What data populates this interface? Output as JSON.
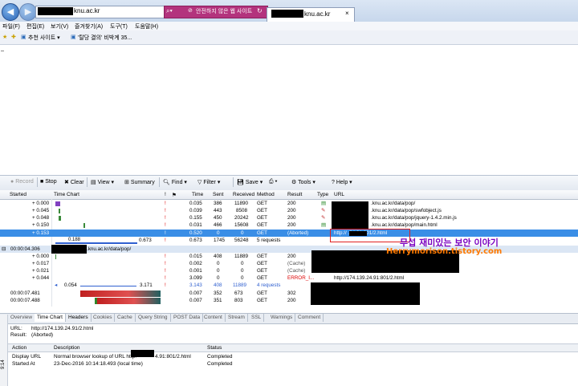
{
  "browser": {
    "address_host": "knu.ac.kr",
    "warning": "안전하지 않은 웹 사이트",
    "tab_title": "knu.ac.kr",
    "menu": [
      "파일(F)",
      "편집(E)",
      "보기(V)",
      "즐겨찾기(A)",
      "도구(T)",
      "도움말(H)"
    ],
    "favorites": [
      "추천 사이트 ▾",
      "'탈당 결의' 비박계 35..."
    ]
  },
  "fiddler": {
    "toolbar": [
      "Record",
      "Stop",
      "Clear",
      "View ▾",
      "Summary",
      "Find ▾",
      "Filter ▾",
      "Save ▾",
      "Tools ▾",
      "Help ▾"
    ],
    "columns": [
      "Started",
      "Time Chart",
      "!",
      "Time",
      "Sent",
      "Received",
      "Method",
      "Result",
      "Type",
      "URL"
    ],
    "rows": [
      {
        "started": "+ 0.000",
        "flag": "!",
        "time": "0.035",
        "sent": "386",
        "received": "11890",
        "method": "GET",
        "result": "200",
        "url": ".knu.ac.kr/data/pop/"
      },
      {
        "started": "+ 0.045",
        "flag": "!",
        "time": "0.039",
        "sent": "443",
        "received": "8508",
        "method": "GET",
        "result": "200",
        "url": ".knu.ac.kr/data/pop/swfobject.js"
      },
      {
        "started": "+ 0.048",
        "flag": "!",
        "time": "0.155",
        "sent": "450",
        "received": "20242",
        "method": "GET",
        "result": "200",
        "url": ".knu.ac.kr/data/pop/jquery-1.4.2.min.js"
      },
      {
        "started": "+ 0.150",
        "flag": "!",
        "time": "0.031",
        "sent": "466",
        "received": "15608",
        "method": "GET",
        "result": "200",
        "url": ".knu.ac.kr/data/pop/main.html"
      },
      {
        "started": "+ 0.153",
        "flag": "!",
        "time": "0.520",
        "sent": "0",
        "received": "0",
        "method": "GET",
        "result": "(Aborted)",
        "url": "http://    .24.91:801/2.html"
      }
    ],
    "summary1": {
      "start": "0.188",
      "end": "0.673",
      "flag": "!",
      "time": "0.673",
      "sent": "1745",
      "received": "56248",
      "requests": "5 requests"
    },
    "group": {
      "started": "00:00:04.306",
      "url": ".knu.ac.kr/data/pop/"
    },
    "rows2": [
      {
        "started": "+ 0.000",
        "flag": "!",
        "time": "0.015",
        "sent": "408",
        "received": "11889",
        "method": "GET",
        "result": "200"
      },
      {
        "started": "+ 0.017",
        "flag": "!",
        "time": "0.002",
        "sent": "0",
        "received": "0",
        "method": "GET",
        "result": "(Cache)"
      },
      {
        "started": "+ 0.021",
        "flag": "!",
        "time": "0.001",
        "sent": "0",
        "received": "0",
        "method": "GET",
        "result": "(Cache)"
      },
      {
        "started": "+ 0.044",
        "flag": "!",
        "time": "3.099",
        "sent": "0",
        "received": "0",
        "method": "GET",
        "result": "ERROR_I...",
        "url": "http://174.139.24.91:801/2.html"
      }
    ],
    "summary2": {
      "start": "0.054",
      "end": "3.171",
      "flag": "!",
      "time": "3.143",
      "sent": "408",
      "received": "11889",
      "requests": "4 requests"
    },
    "rows3": [
      {
        "started": "00:00:07.481",
        "time": "0.007",
        "sent": "352",
        "received": "673",
        "method": "GET",
        "result": "302"
      },
      {
        "started": "00:00:07.488",
        "time": "0.007",
        "sent": "351",
        "received": "803",
        "method": "GET",
        "result": "200"
      }
    ],
    "tabs": [
      "Overview",
      "Time Chart",
      "Headers",
      "Cookies",
      "Cache",
      "Query String",
      "POST Data",
      "Content",
      "Stream",
      "SSL",
      "Warnings",
      "Comment"
    ],
    "detail": {
      "url_label": "URL:",
      "url_value": "http://174.139.24.91/2.html",
      "result_label": "Result:",
      "result_value": "(Aborted)",
      "table_headers": [
        "Action",
        "Description",
        "Status"
      ],
      "actions": [
        {
          "action": "Display URL",
          "description_prefix": "Normal browser lookup of URL http:",
          "description_suffix": "4.91:801/2.html",
          "status": "Completed"
        },
        {
          "action": "Started At",
          "description": "23-Dec-2016 10:14:18.493 (local time)",
          "status": "Completed"
        }
      ],
      "side_label": "9:14"
    }
  },
  "watermark": {
    "line1": "무섭 재미있는 보안 이야기",
    "line2": "Herrymorison.tistory.com"
  }
}
